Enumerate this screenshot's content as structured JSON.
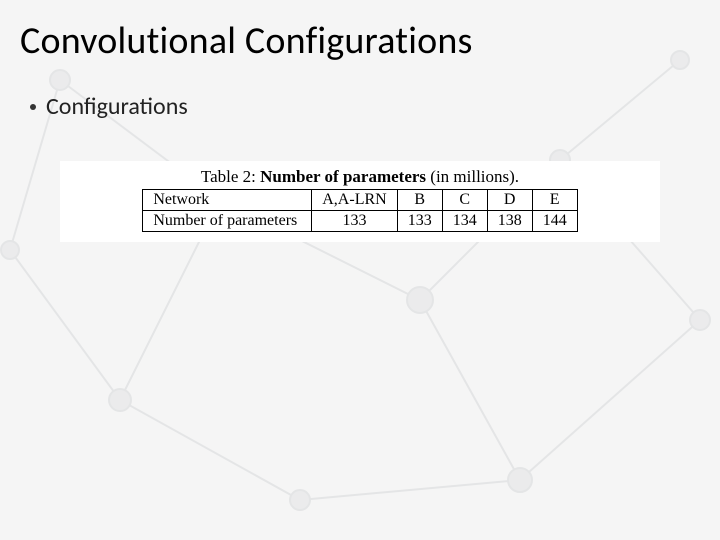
{
  "title": "Convolutional Configurations",
  "bullet": "Configurations",
  "table": {
    "caption_prefix": "Table 2: ",
    "caption_bold": "Number of parameters",
    "caption_suffix": " (in millions).",
    "rows": [
      {
        "label": "Network",
        "c0": "A,A-LRN",
        "c1": "B",
        "c2": "C",
        "c3": "D",
        "c4": "E"
      },
      {
        "label": "Number of parameters",
        "c0": "133",
        "c1": "133",
        "c2": "134",
        "c3": "138",
        "c4": "144"
      }
    ]
  },
  "chart_data": {
    "type": "table",
    "title": "Table 2: Number of parameters (in millions).",
    "columns": [
      "Network",
      "A,A-LRN",
      "B",
      "C",
      "D",
      "E"
    ],
    "rows": [
      [
        "Number of parameters",
        133,
        133,
        134,
        138,
        144
      ]
    ]
  }
}
